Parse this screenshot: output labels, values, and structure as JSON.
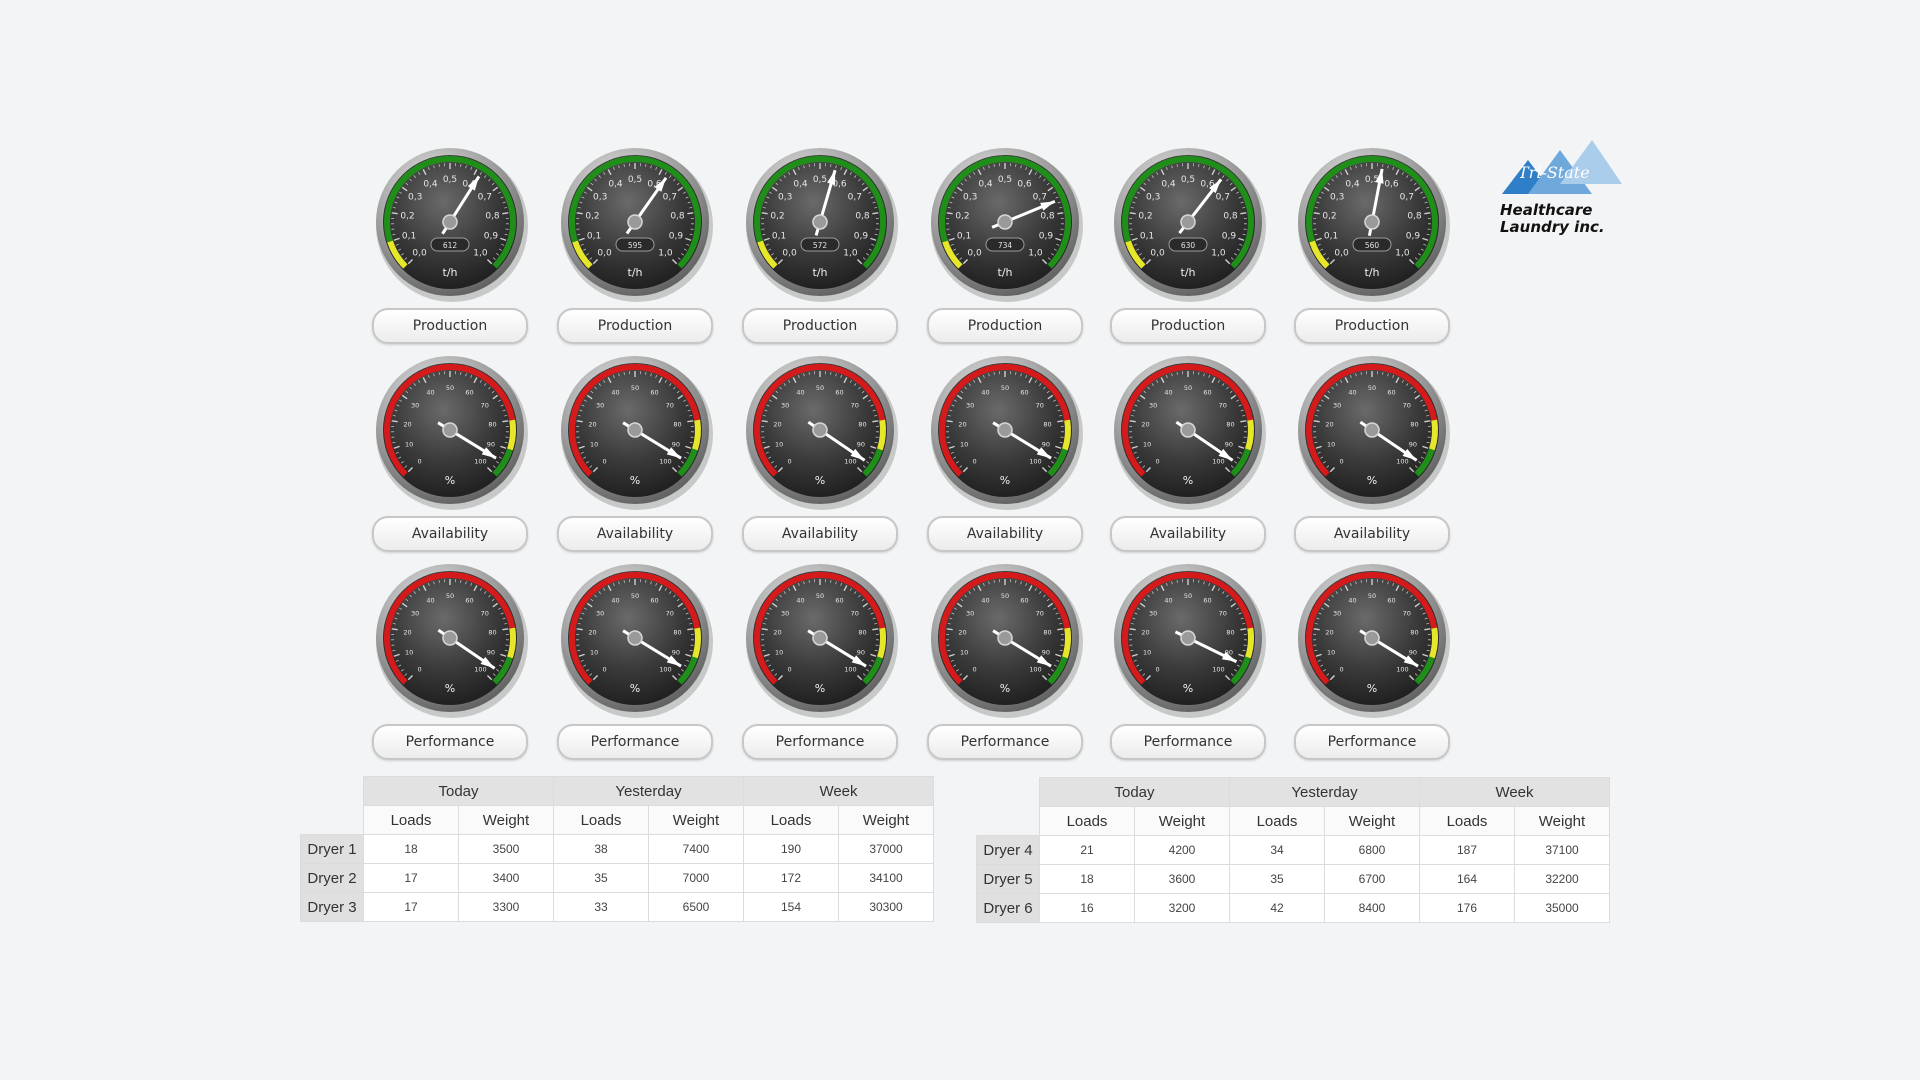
{
  "dryers": [
    {
      "production": {
        "value": 0.62,
        "readout": "612",
        "unit": "t/h",
        "label": "Production"
      },
      "availability": {
        "value": 95,
        "unit": "%",
        "label": "Availability"
      },
      "performance": {
        "value": 96,
        "unit": "%",
        "label": "Performance"
      }
    },
    {
      "production": {
        "value": 0.63,
        "readout": "595",
        "unit": "t/h",
        "label": "Production"
      },
      "availability": {
        "value": 95,
        "unit": "%",
        "label": "Availability"
      },
      "performance": {
        "value": 95,
        "unit": "%",
        "label": "Performance"
      }
    },
    {
      "production": {
        "value": 0.56,
        "readout": "572",
        "unit": "t/h",
        "label": "Production"
      },
      "availability": {
        "value": 96,
        "unit": "%",
        "label": "Availability"
      },
      "performance": {
        "value": 95,
        "unit": "%",
        "label": "Performance"
      }
    },
    {
      "production": {
        "value": 0.75,
        "readout": "734",
        "unit": "t/h",
        "label": "Production"
      },
      "availability": {
        "value": 95,
        "unit": "%",
        "label": "Availability"
      },
      "performance": {
        "value": 95,
        "unit": "%",
        "label": "Performance"
      }
    },
    {
      "production": {
        "value": 0.64,
        "readout": "630",
        "unit": "t/h",
        "label": "Production"
      },
      "availability": {
        "value": 96,
        "unit": "%",
        "label": "Availability"
      },
      "performance": {
        "value": 93,
        "unit": "%",
        "label": "Performance"
      }
    },
    {
      "production": {
        "value": 0.54,
        "readout": "560",
        "unit": "t/h",
        "label": "Production"
      },
      "availability": {
        "value": 96,
        "unit": "%",
        "label": "Availability"
      },
      "performance": {
        "value": 95,
        "unit": "%",
        "label": "Performance"
      }
    }
  ],
  "production_scale": {
    "ticks": [
      "0,0",
      "0,1",
      "0,2",
      "0,3",
      "0,4",
      "0,5",
      "0,6",
      "0,7",
      "0,8",
      "0,9",
      "1,0"
    ],
    "min": 0,
    "max": 1.0,
    "yellow_to": 0.1
  },
  "percent_scale": {
    "ticks": [
      "0",
      "10",
      "20",
      "30",
      "40",
      "50",
      "60",
      "70",
      "80",
      "90",
      "100"
    ],
    "min": 0,
    "max": 100,
    "red_to": 80,
    "yellow_to": 90
  },
  "colors": {
    "green": "#1f8f1a",
    "yellow": "#e6e62a",
    "red": "#d41a1a",
    "dial": "#2b2b2b"
  },
  "logo": {
    "script": "Tri-State",
    "line1": "Healthcare",
    "line2": "Laundry inc.",
    "color": "#3f8fd0"
  },
  "table_left": {
    "groups": [
      "Today",
      "Yesterday",
      "Week"
    ],
    "subs": [
      "Loads",
      "Weight",
      "Loads",
      "Weight",
      "Loads",
      "Weight"
    ],
    "rows": [
      {
        "name": "Dryer 1",
        "values": [
          "18",
          "3500",
          "38",
          "7400",
          "190",
          "37000"
        ]
      },
      {
        "name": "Dryer 2",
        "values": [
          "17",
          "3400",
          "35",
          "7000",
          "172",
          "34100"
        ]
      },
      {
        "name": "Dryer 3",
        "values": [
          "17",
          "3300",
          "33",
          "6500",
          "154",
          "30300"
        ]
      }
    ]
  },
  "table_right": {
    "groups": [
      "Today",
      "Yesterday",
      "Week"
    ],
    "subs": [
      "Loads",
      "Weight",
      "Loads",
      "Weight",
      "Loads",
      "Weight"
    ],
    "rows": [
      {
        "name": "Dryer 4",
        "values": [
          "21",
          "4200",
          "34",
          "6800",
          "187",
          "37100"
        ]
      },
      {
        "name": "Dryer 5",
        "values": [
          "18",
          "3600",
          "35",
          "6700",
          "164",
          "32200"
        ]
      },
      {
        "name": "Dryer 6",
        "values": [
          "16",
          "3200",
          "42",
          "8400",
          "176",
          "35000"
        ]
      }
    ]
  }
}
